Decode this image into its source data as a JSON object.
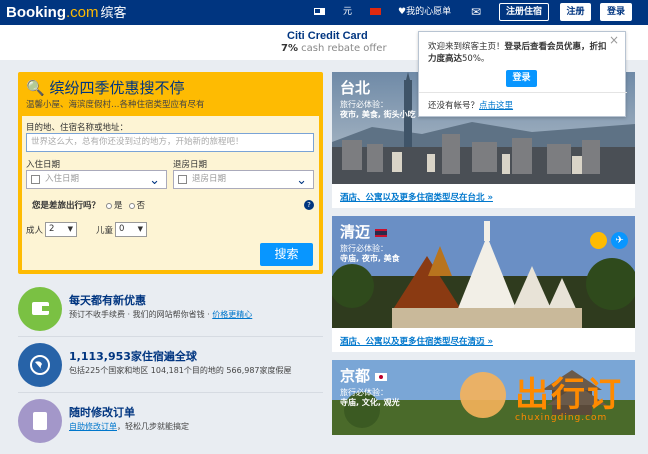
{
  "topbar": {
    "logo_main": "Booking",
    "logo_com": ".com",
    "logo_cn": "缤客",
    "currency": "元",
    "wishlist": "我的心愿单",
    "register_property": "注册住宿",
    "register": "注册",
    "login": "登录"
  },
  "promo": {
    "title": "Citi Credit Card",
    "rate": "7%",
    "text": "cash rebate offer"
  },
  "popup": {
    "line1": "欢迎来到缤客主页！",
    "line1_bold": "登录后查看会员优惠，折扣力度高达",
    "percent": "50%。",
    "button": "登录",
    "no_account": "还没有帐号？",
    "link": "点击这里"
  },
  "search": {
    "title": "缤纷四季优惠搜不停",
    "subtitle": "温馨小屋、海滨度假村…各种住宿类型应有尽有",
    "dest_label": "目的地、住宿名称或地址：",
    "dest_placeholder": "世界这么大，总有你还没到过的地方，开始新的旅程吧！",
    "checkin_label": "入住日期",
    "checkin_placeholder": "入住日期",
    "checkout_label": "退房日期",
    "checkout_placeholder": "退房日期",
    "business_question": "您是差旅出行吗？",
    "yes": "是",
    "no": "否",
    "adults_label": "成人",
    "adults_value": "2",
    "children_label": "儿童",
    "children_value": "0",
    "search_button": "搜索"
  },
  "features": [
    {
      "title": "每天都有新优惠",
      "text": "预订不收手续费 · 我们的网站帮你省钱 · ",
      "link": "价格更精心",
      "color": "#7ac143"
    },
    {
      "title": "1,113,953家住宿遍全球",
      "text": "包括225个国家和地区 104,181个目的地的 566,987家度假屋",
      "link": "",
      "color": "#2763a8"
    },
    {
      "title": "随时修改订单",
      "text": "",
      "link": "自助修改订单",
      "text2": "，轻松几步就能搞定",
      "color": "#a397c9"
    }
  ],
  "destinations": [
    {
      "name": "台北",
      "label": "旅行必体验：",
      "tags": "夜市, 美食, 街头小吃",
      "link": "酒店、公寓以及更多住宿类型尽在台北 »"
    },
    {
      "name": "清迈",
      "label": "旅行必体验：",
      "tags": "寺庙, 夜市, 美食",
      "link": "酒店、公寓以及更多住宿类型尽在清迈 »"
    },
    {
      "name": "京都",
      "label": "旅行必体验：",
      "tags": "寺庙, 文化, 观光",
      "link": ""
    }
  ],
  "watermark": {
    "text": "出行订",
    "url": "chuxingding.com"
  },
  "colors": {
    "brand": "#003580",
    "accent": "#febb02",
    "button": "#0896ff",
    "link": "#0077cc"
  }
}
